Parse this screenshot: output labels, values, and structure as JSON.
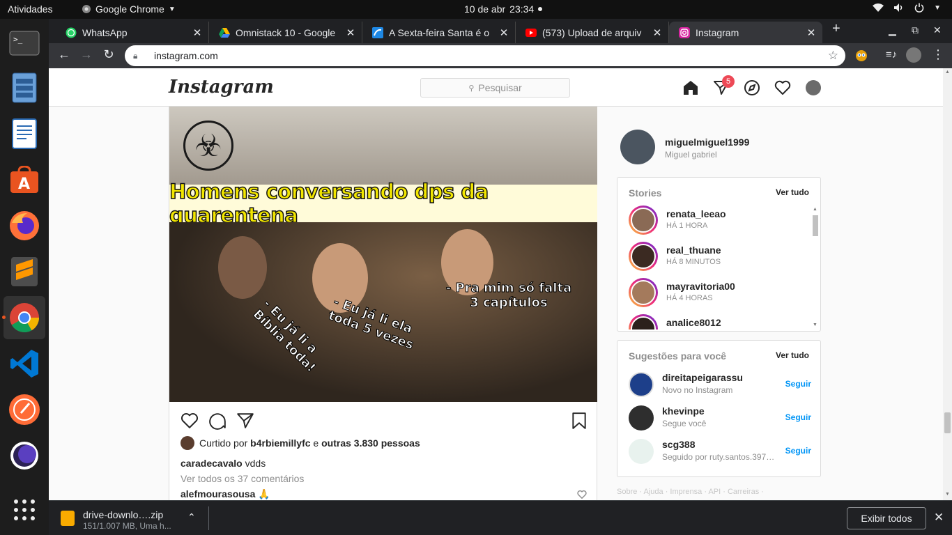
{
  "topbar": {
    "activities": "Atividades",
    "app_name": "Google Chrome",
    "clock_date": "10 de abr",
    "clock_time": "23:34"
  },
  "dock": {
    "items": [
      "terminal-icon",
      "files-icon",
      "writer-icon",
      "software-icon",
      "firefox-icon",
      "sublime-icon",
      "chrome-icon",
      "vscode-icon",
      "postman-icon",
      "eclipse-icon",
      "app-grid-icon"
    ]
  },
  "chrome": {
    "tabs": [
      {
        "title": "WhatsApp",
        "icon": "whatsapp-icon"
      },
      {
        "title": "Omnistack 10 - Google",
        "icon": "drive-icon"
      },
      {
        "title": "A Sexta-feira Santa é o",
        "icon": "news-icon"
      },
      {
        "title": "(573) Upload de arquiv",
        "icon": "youtube-icon"
      },
      {
        "title": "Instagram",
        "icon": "instagram-icon"
      }
    ],
    "url": "instagram.com"
  },
  "instagram": {
    "logo": "Instagram",
    "search_placeholder": "Pesquisar",
    "direct_badge": "5",
    "post": {
      "image_caption_top": "Homens conversando dps da quarentena",
      "image_caption_1": "- Eu já li a Bíblia toda!",
      "image_caption_2": "- Eu já li ela toda 5 vezes",
      "image_caption_3": "- Pra mim só falta 3 capítulos",
      "liked_prefix": "Curtido por",
      "liked_user": "b4rbiemillyfc",
      "liked_and": "e",
      "liked_others": "outras 3.830 pessoas",
      "caption_user": "caradecavalo",
      "caption_text": "vdds",
      "view_all": "Ver todos os 37 comentários",
      "comment_user": "alefmourasousa",
      "comment_text": "🙏"
    },
    "profile": {
      "username": "miguelmiguel1999",
      "name": "Miguel gabriel"
    },
    "stories": {
      "title": "Stories",
      "see_all": "Ver tudo",
      "items": [
        {
          "user": "renata_leeao",
          "time": "HÁ 1 HORA"
        },
        {
          "user": "real_thuane",
          "time": "HÁ 8 MINUTOS"
        },
        {
          "user": "mayravitoria00",
          "time": "HÁ 4 HORAS"
        },
        {
          "user": "analice8012",
          "time": ""
        }
      ]
    },
    "suggestions": {
      "title": "Sugestões para você",
      "see_all": "Ver tudo",
      "follow": "Seguir",
      "items": [
        {
          "user": "direitapeigarassu",
          "sub": "Novo no Instagram"
        },
        {
          "user": "khevinpe",
          "sub": "Segue você"
        },
        {
          "user": "scg388",
          "sub": "Seguido por ruty.santos.397…"
        }
      ]
    },
    "footer": "Sobre · Ajuda · Imprensa · API · Carreiras ·"
  },
  "download": {
    "file": "drive-downlo….zip",
    "progress": "151/1.007 MB, Uma h...",
    "show_all": "Exibir todos"
  }
}
